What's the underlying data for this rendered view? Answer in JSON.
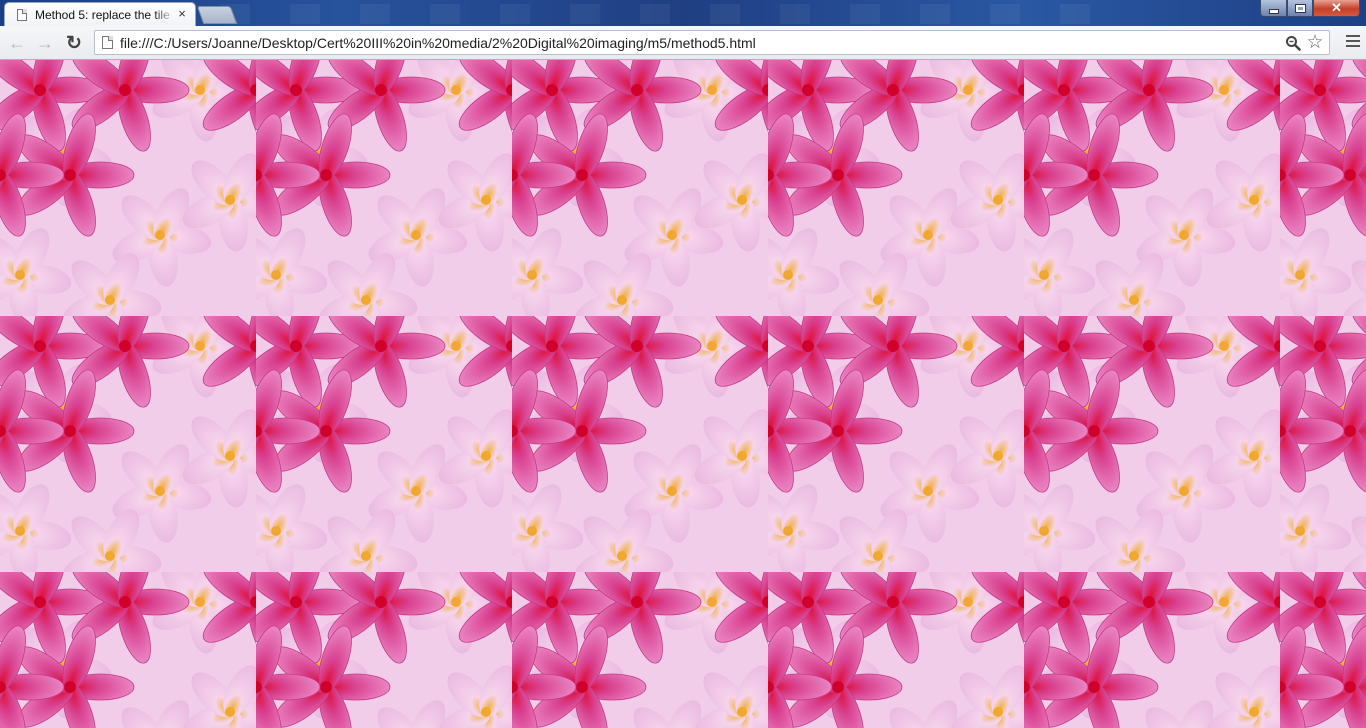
{
  "window": {
    "tab_title": "Method 5: replace the tile",
    "tab_close": "×",
    "min_label": "",
    "close_label": "✕"
  },
  "toolbar": {
    "back_glyph": "←",
    "forward_glyph": "→",
    "reload_glyph": "↻",
    "url": "file:///C:/Users/Joanne/Desktop/Cert%20III%20in%20media/2%20Digital%20imaging/m5/method5.html",
    "star_glyph": "☆"
  },
  "icons": {
    "tab": "page-icon",
    "back": "arrow-left-icon",
    "forward": "arrow-right-icon",
    "reload": "reload-icon",
    "omnibox": "page-icon",
    "zoom": "magnifier-icon",
    "bookmark": "star-icon",
    "menu": "hamburger-menu-icon"
  },
  "colors": {
    "titlebar": "#1f4389",
    "petal_pink": "#e060a8",
    "petal_light": "#f3c7e6",
    "flower_center": "#e0103c",
    "flower_yellow": "#f0b040"
  }
}
